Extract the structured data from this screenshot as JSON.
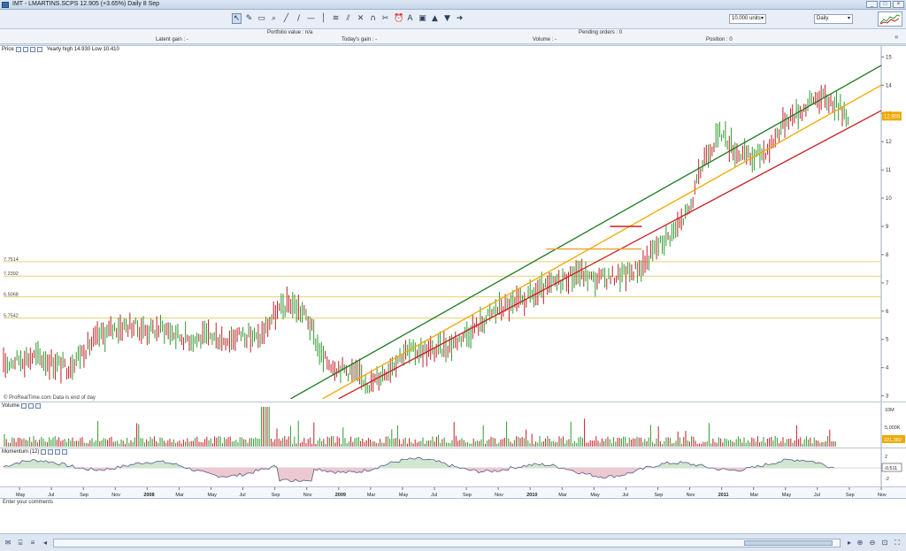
{
  "window": {
    "title": "IMT - LMARTINS.SCPS   12.905 (+3.65%)   Daily  8 Sep",
    "controls": [
      "_",
      "□",
      "×"
    ]
  },
  "toolbar": {
    "tools": [
      {
        "name": "pointer-icon",
        "glyph": "↖",
        "selected": true
      },
      {
        "name": "pencil-icon",
        "glyph": "✎"
      },
      {
        "name": "eraser-icon",
        "glyph": "▭"
      },
      {
        "name": "zoom-icon",
        "glyph": "⌕"
      },
      {
        "name": "trendline-icon",
        "glyph": "╱"
      },
      {
        "name": "line-icon",
        "glyph": "/"
      },
      {
        "name": "horizontal-line-icon",
        "glyph": "—"
      },
      {
        "name": "vertical-line-icon",
        "glyph": "│"
      },
      {
        "name": "fibonacci-icon",
        "glyph": "≋"
      },
      {
        "name": "channel-icon",
        "glyph": "⫽"
      },
      {
        "name": "cross-icon",
        "glyph": "✕"
      },
      {
        "name": "magnet-icon",
        "glyph": "∩"
      },
      {
        "name": "scissors-icon",
        "glyph": "✂"
      },
      {
        "name": "alarm-icon",
        "glyph": "⏰"
      },
      {
        "name": "text-icon",
        "glyph": "A"
      },
      {
        "name": "rectangle-icon",
        "glyph": "▣"
      },
      {
        "name": "up-arrow-icon",
        "glyph": "▲"
      },
      {
        "name": "down-arrow-icon",
        "glyph": "▼"
      },
      {
        "name": "right-arrow-icon",
        "glyph": "➜"
      }
    ],
    "units_select": "10.000 units",
    "period_select": "Daily"
  },
  "info": {
    "portfolio": "Portfolio value : n/a",
    "pending": "Pending orders : 0",
    "latent": "Latent gain : -",
    "todays": "Today's gain : -",
    "volume": "Volume : -",
    "position": "Position : 0"
  },
  "price_panel": {
    "label": "Price",
    "range": "Yearly high 14.930  Low 10.410",
    "last_price": "12.905",
    "source": "© ProRealTime.com  Data is end of day",
    "levels": [
      "7.7514",
      "7.2392",
      "6.5068",
      "5.7542"
    ]
  },
  "volume_panel": {
    "label": "Volume",
    "last": "321,382",
    "ticks": [
      "10M",
      "5,000K"
    ]
  },
  "momentum_panel": {
    "label": "Momentum (12)",
    "last": "-0.511",
    "ticks": [
      "2",
      "-2"
    ]
  },
  "comment": {
    "placeholder": "Enter your comments"
  },
  "colors": {
    "up": "#2f9a2f",
    "down": "#c0202a",
    "channel_top": "#1c7a1c",
    "channel_mid": "#f0a800",
    "channel_bottom": "#c81e1e",
    "level": "#e9cf70",
    "momentum_pos": "#cfe6cf",
    "momentum_neg": "#ecc8d0"
  },
  "chart_data": {
    "type": "line",
    "title": "",
    "xlabel": "",
    "ylabel": "",
    "ylim": [
      2.8,
      15.2
    ],
    "y_ticks": [
      3,
      4,
      5,
      6,
      7,
      8,
      9,
      10,
      11,
      12,
      13,
      14,
      15
    ],
    "x_ticks": [
      "May",
      "Jul",
      "Sep",
      "Nov",
      "2008",
      "Mar",
      "May",
      "Jul",
      "Sep",
      "Nov",
      "2009",
      "Mar",
      "May",
      "Jul",
      "Sep",
      "Nov",
      "2010",
      "Mar",
      "May",
      "Jul",
      "Sep",
      "Nov",
      "2011",
      "Mar",
      "May",
      "Jul",
      "Sep",
      "Nov"
    ],
    "x_range": [
      "2007-04",
      "2011-11"
    ],
    "price_series": {
      "name": "",
      "x": [
        "2007-04",
        "2007-05",
        "2007-06",
        "2007-07",
        "2007-08",
        "2007-09",
        "2007-10",
        "2007-11",
        "2007-12",
        "2008-01",
        "2008-02",
        "2008-03",
        "2008-04",
        "2008-05",
        "2008-06",
        "2008-07",
        "2008-08",
        "2008-09",
        "2008-10",
        "2008-11",
        "2008-12",
        "2009-01",
        "2009-02",
        "2009-03",
        "2009-04",
        "2009-05",
        "2009-06",
        "2009-07",
        "2009-08",
        "2009-09",
        "2009-10",
        "2009-11",
        "2009-12",
        "2010-01",
        "2010-02",
        "2010-03",
        "2010-04",
        "2010-05",
        "2010-06",
        "2010-07",
        "2010-08",
        "2010-09",
        "2010-10",
        "2010-11",
        "2010-12",
        "2011-01",
        "2011-02",
        "2011-03",
        "2011-04",
        "2011-05",
        "2011-06",
        "2011-07",
        "2011-08",
        "2011-09"
      ],
      "y": [
        4.1,
        4.3,
        4.4,
        4.2,
        4.0,
        4.6,
        5.1,
        5.4,
        5.5,
        5.3,
        5.4,
        5.1,
        5.0,
        5.1,
        5.0,
        5.2,
        5.0,
        5.9,
        6.3,
        5.8,
        4.3,
        4.0,
        3.8,
        3.4,
        3.9,
        4.5,
        4.6,
        4.6,
        4.8,
        5.2,
        5.6,
        6.1,
        6.2,
        6.5,
        6.8,
        7.1,
        7.4,
        7.1,
        7.2,
        7.3,
        7.6,
        8.3,
        8.8,
        9.6,
        11.6,
        12.3,
        11.6,
        11.4,
        11.8,
        12.8,
        13.1,
        13.6,
        13.4,
        12.9
      ]
    },
    "trendlines": [
      {
        "name": "",
        "color": "channel_top",
        "from": [
          "2008-10",
          2.9
        ],
        "to": [
          "2011-11",
          14.7
        ]
      },
      {
        "name": "",
        "color": "channel_mid",
        "from": [
          "2008-12",
          2.9
        ],
        "to": [
          "2011-11",
          14.0
        ]
      },
      {
        "name": "",
        "color": "channel_bottom",
        "from": [
          "2009-01",
          2.9
        ],
        "to": [
          "2011-11",
          13.1
        ]
      }
    ],
    "horizontal_levels": [
      7.7514,
      7.2392,
      6.5068,
      5.7542
    ],
    "resistance_boxes": [
      {
        "from": "2010-02",
        "to": "2010-08",
        "y": 8.2,
        "color": "#e8a73a"
      },
      {
        "from": "2010-06",
        "to": "2010-08",
        "y": 9.0,
        "color": "#c82020"
      }
    ],
    "grid": false,
    "legend": "none"
  }
}
